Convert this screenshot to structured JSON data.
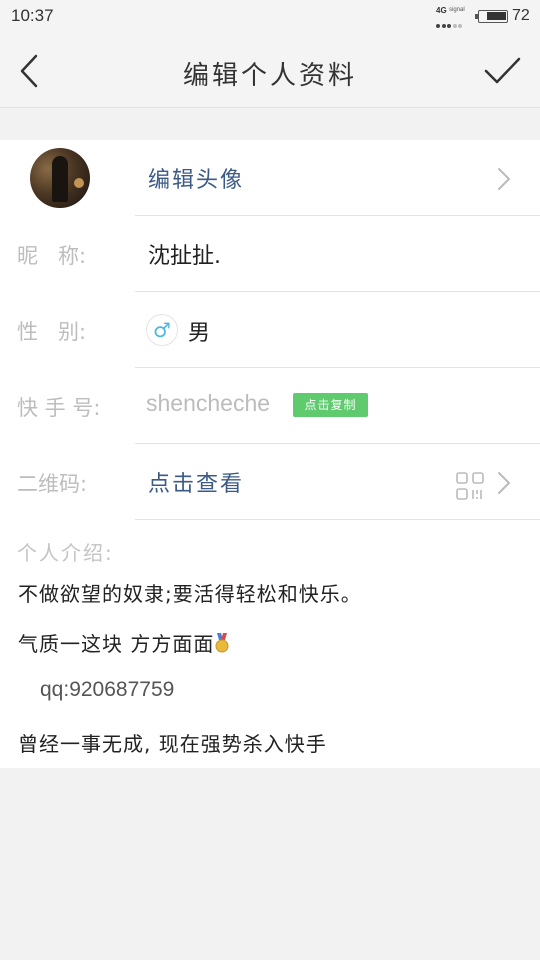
{
  "status_bar": {
    "time": "10:37",
    "network": "4G",
    "signal_label": "signal",
    "battery": "72"
  },
  "nav": {
    "title": "编辑个人资料",
    "back_icon": "chevron-left-icon",
    "confirm_icon": "checkmark-icon"
  },
  "profile": {
    "avatar_label": "编辑头像",
    "nickname_label": "昵   称:",
    "nickname": "沈扯扯.",
    "gender_label": "性   别:",
    "gender_symbol": "♂",
    "gender": "男",
    "kwai_label": "快 手 号:",
    "kwai_id": "shencheche",
    "copy_button": "点击复制",
    "qr_label": "二维码:",
    "qr_action": "点击查看",
    "bio_label": "个人介绍:",
    "bio_lines": [
      "不做欲望的奴隶;要活得轻松和快乐。",
      "气质一这块 方方面面",
      "qq:920687759",
      "曾经一事无成, 现在强势杀入快手"
    ]
  },
  "colors": {
    "link": "#3b5a86",
    "copy_badge": "#5fcb6e",
    "gender_icon": "#4bb6e0",
    "label": "#bdbdbd"
  }
}
